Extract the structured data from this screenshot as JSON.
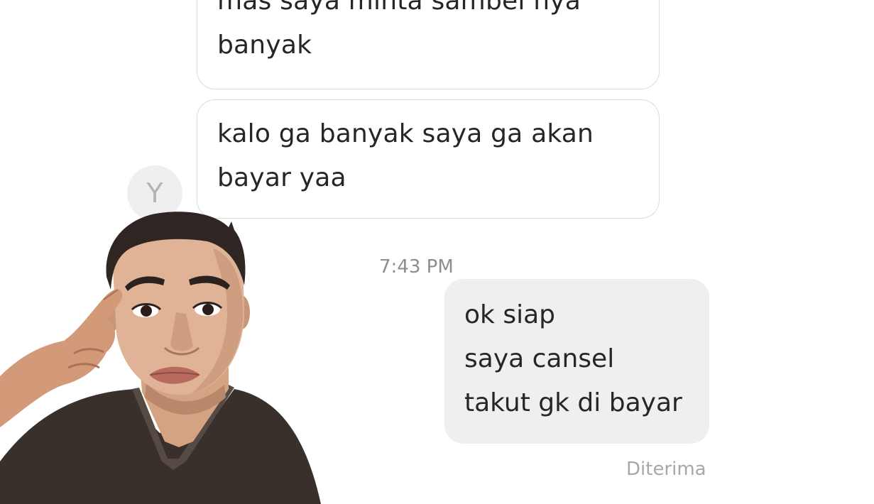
{
  "conversation": {
    "incoming": [
      {
        "lines": [
          "mas saya minta sambel nya",
          "banyak"
        ]
      },
      {
        "lines": [
          "kalo ga banyak saya ga akan",
          "bayar yaa"
        ]
      }
    ],
    "avatar_initial": "Y",
    "timestamp": "7:43 PM",
    "outgoing": {
      "lines": [
        "ok siap",
        "saya cansel",
        "takut gk di bayar"
      ]
    },
    "status": "Diterima"
  },
  "sticker": {
    "icon": "man-thinking-sticker-icon"
  },
  "colors": {
    "incoming_bubble_border": "#dbdbdb",
    "outgoing_bubble_bg": "#efefef",
    "text": "#262626",
    "meta_text": "#8e8e8e"
  }
}
